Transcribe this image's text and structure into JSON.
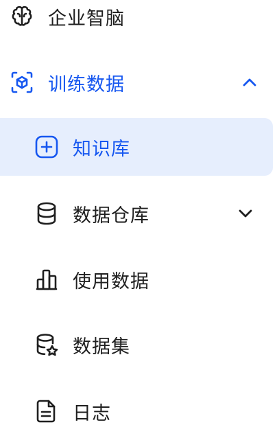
{
  "menu": {
    "ai_brain": {
      "label": "企业智脑",
      "icon": "brain-icon"
    },
    "training_data": {
      "label": "训练数据",
      "icon": "cube-scan-icon",
      "expanded": true,
      "accent": "#1657f0"
    },
    "knowledge_base": {
      "label": "知识库",
      "icon": "add-square-icon",
      "active": true,
      "active_bg": "#e6eefd"
    },
    "data_warehouse": {
      "label": "数据仓库",
      "icon": "database-icon",
      "expanded": false
    },
    "usage_data": {
      "label": "使用数据",
      "icon": "bar-chart-icon"
    },
    "dataset": {
      "label": "数据集",
      "icon": "database-star-icon"
    },
    "logs": {
      "label": "日志",
      "icon": "document-icon"
    }
  }
}
